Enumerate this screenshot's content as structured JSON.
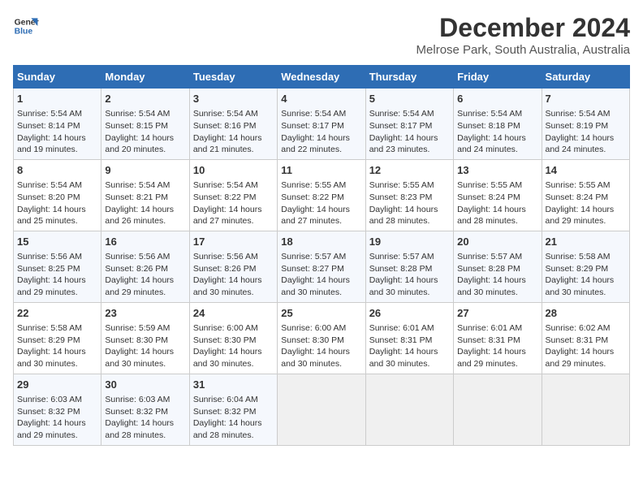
{
  "logo": {
    "line1": "General",
    "line2": "Blue"
  },
  "title": "December 2024",
  "subtitle": "Melrose Park, South Australia, Australia",
  "weekdays": [
    "Sunday",
    "Monday",
    "Tuesday",
    "Wednesday",
    "Thursday",
    "Friday",
    "Saturday"
  ],
  "weeks": [
    [
      {
        "day": "1",
        "lines": [
          "Sunrise: 5:54 AM",
          "Sunset: 8:14 PM",
          "Daylight: 14 hours",
          "and 19 minutes."
        ]
      },
      {
        "day": "2",
        "lines": [
          "Sunrise: 5:54 AM",
          "Sunset: 8:15 PM",
          "Daylight: 14 hours",
          "and 20 minutes."
        ]
      },
      {
        "day": "3",
        "lines": [
          "Sunrise: 5:54 AM",
          "Sunset: 8:16 PM",
          "Daylight: 14 hours",
          "and 21 minutes."
        ]
      },
      {
        "day": "4",
        "lines": [
          "Sunrise: 5:54 AM",
          "Sunset: 8:17 PM",
          "Daylight: 14 hours",
          "and 22 minutes."
        ]
      },
      {
        "day": "5",
        "lines": [
          "Sunrise: 5:54 AM",
          "Sunset: 8:17 PM",
          "Daylight: 14 hours",
          "and 23 minutes."
        ]
      },
      {
        "day": "6",
        "lines": [
          "Sunrise: 5:54 AM",
          "Sunset: 8:18 PM",
          "Daylight: 14 hours",
          "and 24 minutes."
        ]
      },
      {
        "day": "7",
        "lines": [
          "Sunrise: 5:54 AM",
          "Sunset: 8:19 PM",
          "Daylight: 14 hours",
          "and 24 minutes."
        ]
      }
    ],
    [
      {
        "day": "8",
        "lines": [
          "Sunrise: 5:54 AM",
          "Sunset: 8:20 PM",
          "Daylight: 14 hours",
          "and 25 minutes."
        ]
      },
      {
        "day": "9",
        "lines": [
          "Sunrise: 5:54 AM",
          "Sunset: 8:21 PM",
          "Daylight: 14 hours",
          "and 26 minutes."
        ]
      },
      {
        "day": "10",
        "lines": [
          "Sunrise: 5:54 AM",
          "Sunset: 8:22 PM",
          "Daylight: 14 hours",
          "and 27 minutes."
        ]
      },
      {
        "day": "11",
        "lines": [
          "Sunrise: 5:55 AM",
          "Sunset: 8:22 PM",
          "Daylight: 14 hours",
          "and 27 minutes."
        ]
      },
      {
        "day": "12",
        "lines": [
          "Sunrise: 5:55 AM",
          "Sunset: 8:23 PM",
          "Daylight: 14 hours",
          "and 28 minutes."
        ]
      },
      {
        "day": "13",
        "lines": [
          "Sunrise: 5:55 AM",
          "Sunset: 8:24 PM",
          "Daylight: 14 hours",
          "and 28 minutes."
        ]
      },
      {
        "day": "14",
        "lines": [
          "Sunrise: 5:55 AM",
          "Sunset: 8:24 PM",
          "Daylight: 14 hours",
          "and 29 minutes."
        ]
      }
    ],
    [
      {
        "day": "15",
        "lines": [
          "Sunrise: 5:56 AM",
          "Sunset: 8:25 PM",
          "Daylight: 14 hours",
          "and 29 minutes."
        ]
      },
      {
        "day": "16",
        "lines": [
          "Sunrise: 5:56 AM",
          "Sunset: 8:26 PM",
          "Daylight: 14 hours",
          "and 29 minutes."
        ]
      },
      {
        "day": "17",
        "lines": [
          "Sunrise: 5:56 AM",
          "Sunset: 8:26 PM",
          "Daylight: 14 hours",
          "and 30 minutes."
        ]
      },
      {
        "day": "18",
        "lines": [
          "Sunrise: 5:57 AM",
          "Sunset: 8:27 PM",
          "Daylight: 14 hours",
          "and 30 minutes."
        ]
      },
      {
        "day": "19",
        "lines": [
          "Sunrise: 5:57 AM",
          "Sunset: 8:28 PM",
          "Daylight: 14 hours",
          "and 30 minutes."
        ]
      },
      {
        "day": "20",
        "lines": [
          "Sunrise: 5:57 AM",
          "Sunset: 8:28 PM",
          "Daylight: 14 hours",
          "and 30 minutes."
        ]
      },
      {
        "day": "21",
        "lines": [
          "Sunrise: 5:58 AM",
          "Sunset: 8:29 PM",
          "Daylight: 14 hours",
          "and 30 minutes."
        ]
      }
    ],
    [
      {
        "day": "22",
        "lines": [
          "Sunrise: 5:58 AM",
          "Sunset: 8:29 PM",
          "Daylight: 14 hours",
          "and 30 minutes."
        ]
      },
      {
        "day": "23",
        "lines": [
          "Sunrise: 5:59 AM",
          "Sunset: 8:30 PM",
          "Daylight: 14 hours",
          "and 30 minutes."
        ]
      },
      {
        "day": "24",
        "lines": [
          "Sunrise: 6:00 AM",
          "Sunset: 8:30 PM",
          "Daylight: 14 hours",
          "and 30 minutes."
        ]
      },
      {
        "day": "25",
        "lines": [
          "Sunrise: 6:00 AM",
          "Sunset: 8:30 PM",
          "Daylight: 14 hours",
          "and 30 minutes."
        ]
      },
      {
        "day": "26",
        "lines": [
          "Sunrise: 6:01 AM",
          "Sunset: 8:31 PM",
          "Daylight: 14 hours",
          "and 30 minutes."
        ]
      },
      {
        "day": "27",
        "lines": [
          "Sunrise: 6:01 AM",
          "Sunset: 8:31 PM",
          "Daylight: 14 hours",
          "and 29 minutes."
        ]
      },
      {
        "day": "28",
        "lines": [
          "Sunrise: 6:02 AM",
          "Sunset: 8:31 PM",
          "Daylight: 14 hours",
          "and 29 minutes."
        ]
      }
    ],
    [
      {
        "day": "29",
        "lines": [
          "Sunrise: 6:03 AM",
          "Sunset: 8:32 PM",
          "Daylight: 14 hours",
          "and 29 minutes."
        ]
      },
      {
        "day": "30",
        "lines": [
          "Sunrise: 6:03 AM",
          "Sunset: 8:32 PM",
          "Daylight: 14 hours",
          "and 28 minutes."
        ]
      },
      {
        "day": "31",
        "lines": [
          "Sunrise: 6:04 AM",
          "Sunset: 8:32 PM",
          "Daylight: 14 hours",
          "and 28 minutes."
        ]
      },
      null,
      null,
      null,
      null
    ]
  ]
}
